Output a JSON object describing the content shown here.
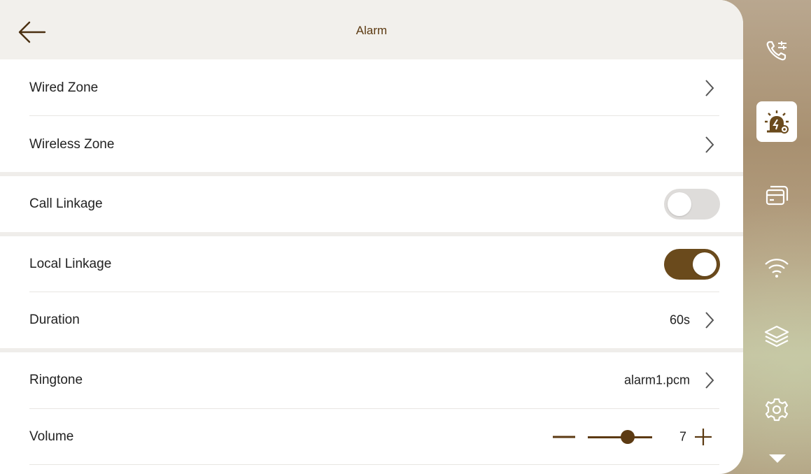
{
  "header": {
    "title": "Alarm",
    "back_icon": "arrow-left-icon"
  },
  "rows": {
    "wired_zone": {
      "label": "Wired Zone"
    },
    "wireless_zone": {
      "label": "Wireless Zone"
    },
    "call_linkage": {
      "label": "Call Linkage",
      "state": "off"
    },
    "local_linkage": {
      "label": "Local Linkage",
      "state": "on"
    },
    "duration": {
      "label": "Duration",
      "value": "60s"
    },
    "ringtone": {
      "label": "Ringtone",
      "value": "alarm1.pcm"
    },
    "volume": {
      "label": "Volume",
      "value": "7",
      "level_fraction": 0.7
    }
  },
  "sidebar": {
    "items": [
      {
        "icon": "call-settings-icon"
      },
      {
        "icon": "alarm-settings-icon",
        "active": true
      },
      {
        "icon": "card-icon"
      },
      {
        "icon": "wifi-icon"
      },
      {
        "icon": "layers-icon"
      },
      {
        "icon": "gear-icon"
      }
    ],
    "more_icon": "triangle-down-icon"
  },
  "colors": {
    "accent": "#6a4a1c",
    "title": "#5c3a12",
    "header_bg": "#f2f0ec",
    "toggle_off": "#dedcda"
  }
}
